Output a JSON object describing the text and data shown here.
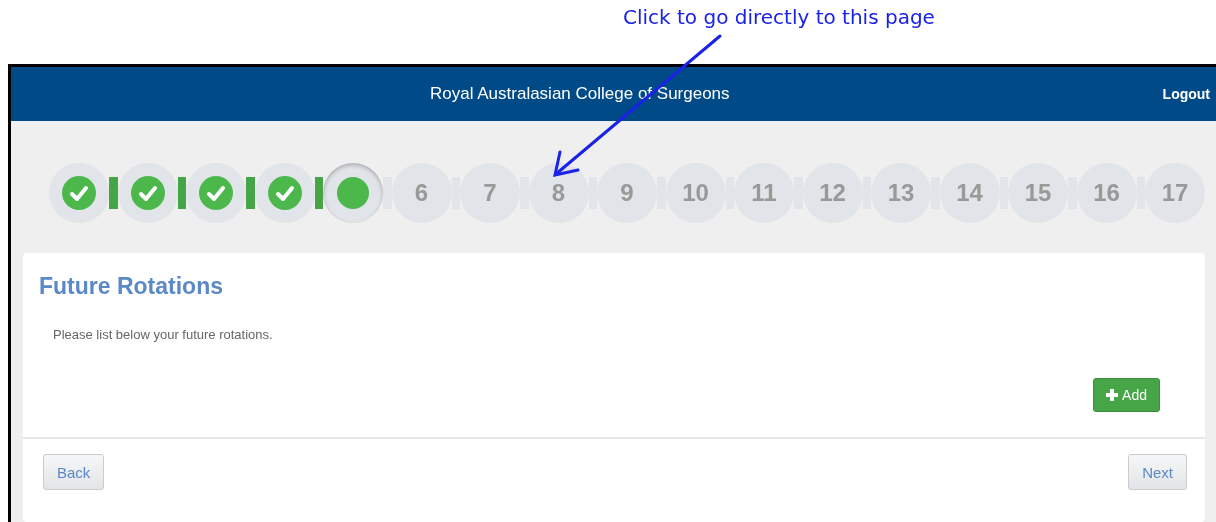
{
  "annotation": {
    "text": "Click to go directly to this page"
  },
  "header": {
    "title": "Royal Australasian College of Surgeons",
    "logout": "Logout"
  },
  "steps": [
    {
      "kind": "done"
    },
    {
      "kind": "done"
    },
    {
      "kind": "done"
    },
    {
      "kind": "done"
    },
    {
      "kind": "current"
    },
    {
      "kind": "pending",
      "label": "6"
    },
    {
      "kind": "pending",
      "label": "7"
    },
    {
      "kind": "pending",
      "label": "8"
    },
    {
      "kind": "pending",
      "label": "9"
    },
    {
      "kind": "pending",
      "label": "10"
    },
    {
      "kind": "pending",
      "label": "11"
    },
    {
      "kind": "pending",
      "label": "12"
    },
    {
      "kind": "pending",
      "label": "13"
    },
    {
      "kind": "pending",
      "label": "14"
    },
    {
      "kind": "pending",
      "label": "15"
    },
    {
      "kind": "pending",
      "label": "16"
    },
    {
      "kind": "pending",
      "label": "17"
    }
  ],
  "card": {
    "title": "Future Rotations",
    "description": "Please list below your future rotations.",
    "add_button": "Add"
  },
  "footer": {
    "back": "Back",
    "next": "Next"
  }
}
